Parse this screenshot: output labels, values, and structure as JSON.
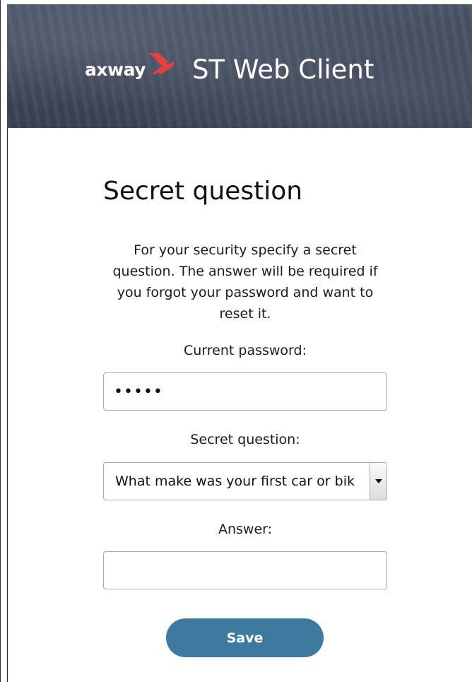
{
  "header": {
    "brand_word": "axway",
    "app_title": "ST Web Client"
  },
  "form": {
    "title": "Secret question",
    "description": "For your security specify a secret question. The answer will be required if you forgot your password and want to reset it.",
    "current_password_label": "Current password:",
    "current_password_value": "•••••",
    "secret_question_label": "Secret question:",
    "secret_question_value": "What make was your first car or bik",
    "answer_label": "Answer:",
    "answer_value": "",
    "save_label": "Save"
  },
  "colors": {
    "header_bg": "#424a5c",
    "brand_accent": "#e8413c",
    "button_bg": "#3e7aa0"
  },
  "icons": {
    "brand_mark": "axway-chevron-logo",
    "select_arrow": "caret-down-icon"
  }
}
